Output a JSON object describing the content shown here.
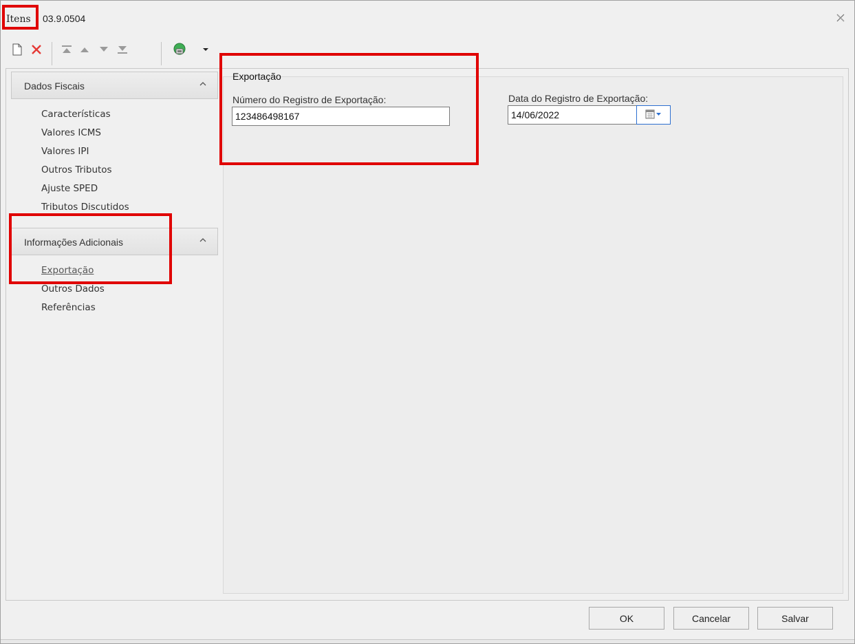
{
  "window": {
    "app_label": "Itens",
    "code": "03.9.0504",
    "close_icon": "close-icon"
  },
  "toolbar": {
    "icons": [
      "new-document-icon",
      "delete-icon",
      "move-first-icon",
      "move-up-icon",
      "move-down-icon",
      "move-last-icon",
      "network-icon",
      "dropdown-arrow-icon"
    ]
  },
  "sidebar": {
    "groups": [
      {
        "title": "Dados Fiscais",
        "items": [
          "Características",
          "Valores ICMS",
          "Valores IPI",
          "Outros Tributos",
          "Ajuste SPED",
          "Tributos Discutidos"
        ]
      },
      {
        "title": "Informações Adicionais",
        "items": [
          "Exportação",
          "Outros Dados",
          "Referências"
        ],
        "active_item": "Exportação"
      }
    ]
  },
  "main": {
    "section_title": "Exportação",
    "numero_label": "Número do Registro de Exportação:",
    "numero_value": "123486498167",
    "data_label": "Data do Registro de Exportação:",
    "data_value": "14/06/2022"
  },
  "buttons": {
    "ok": "OK",
    "cancelar": "Cancelar",
    "salvar": "Salvar"
  },
  "colors": {
    "highlight_box": "#e00000",
    "delete_icon": "#e53935",
    "date_button_border": "#2c6fd0"
  }
}
